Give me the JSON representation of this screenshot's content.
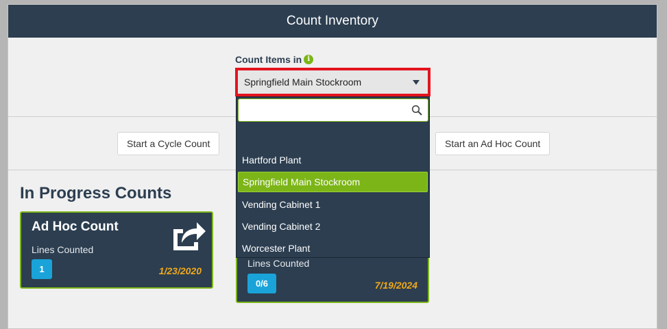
{
  "header": {
    "title": "Count Inventory"
  },
  "location_select": {
    "label": "Count Items in",
    "selected_value": "Springfield Main Stockroom",
    "search_placeholder": "",
    "options": [
      {
        "label": ""
      },
      {
        "label": "Hartford Plant"
      },
      {
        "label": "Springfield Main Stockroom"
      },
      {
        "label": "Vending Cabinet 1"
      },
      {
        "label": "Vending Cabinet 2"
      },
      {
        "label": "Worcester Plant"
      }
    ],
    "highlighted_index": 2
  },
  "actions": {
    "cycle_count_label": "Start a Cycle Count",
    "adhoc_count_label": "Start an Ad Hoc Count"
  },
  "in_progress": {
    "title": "In Progress Counts",
    "cards": [
      {
        "title": "Ad Hoc Count",
        "lines_label": "Lines Counted",
        "lines_value": "1",
        "date": "1/23/2020"
      },
      {
        "title": "",
        "lines_label": "Lines Counted",
        "lines_value": "0/6",
        "date": "7/19/2024"
      }
    ]
  },
  "colors": {
    "header_bg": "#2c3e50",
    "accent_green": "#7cb518",
    "badge_blue": "#1aa3d9",
    "date_orange": "#f0a81c",
    "highlight_red": "#e3141e"
  },
  "icons": {
    "info": "info-icon",
    "dropdown_arrow": "caret-down-icon",
    "search": "search-icon",
    "share": "share-icon"
  }
}
